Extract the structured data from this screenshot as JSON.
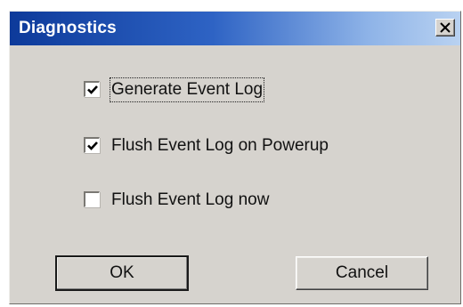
{
  "dialog": {
    "title": "Diagnostics",
    "close_glyph": "close-icon"
  },
  "options": [
    {
      "label": "Generate Event Log",
      "checked": true
    },
    {
      "label": "Flush Event Log on Powerup",
      "checked": true
    },
    {
      "label": "Flush Event Log now",
      "checked": false
    }
  ],
  "buttons": {
    "ok_label": "OK",
    "cancel_label": "Cancel"
  },
  "colors": {
    "title_gradient_start": "#0d3a9a",
    "title_gradient_end": "#b9d2f1",
    "dialog_face": "#d6d3ce"
  }
}
